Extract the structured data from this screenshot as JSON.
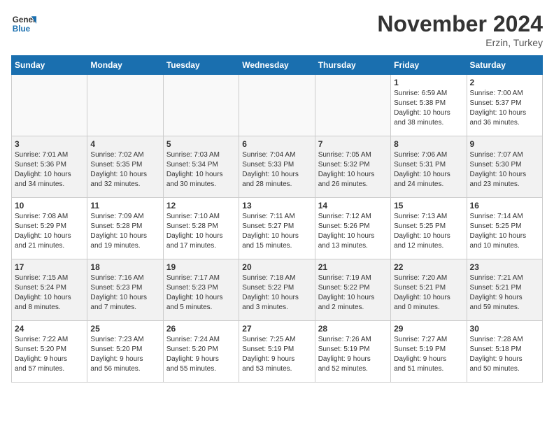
{
  "header": {
    "logo_line1": "General",
    "logo_line2": "Blue",
    "month": "November 2024",
    "location": "Erzin, Turkey"
  },
  "days_of_week": [
    "Sunday",
    "Monday",
    "Tuesday",
    "Wednesday",
    "Thursday",
    "Friday",
    "Saturday"
  ],
  "weeks": [
    [
      {
        "day": "",
        "info": ""
      },
      {
        "day": "",
        "info": ""
      },
      {
        "day": "",
        "info": ""
      },
      {
        "day": "",
        "info": ""
      },
      {
        "day": "",
        "info": ""
      },
      {
        "day": "1",
        "info": "Sunrise: 6:59 AM\nSunset: 5:38 PM\nDaylight: 10 hours\nand 38 minutes."
      },
      {
        "day": "2",
        "info": "Sunrise: 7:00 AM\nSunset: 5:37 PM\nDaylight: 10 hours\nand 36 minutes."
      }
    ],
    [
      {
        "day": "3",
        "info": "Sunrise: 7:01 AM\nSunset: 5:36 PM\nDaylight: 10 hours\nand 34 minutes."
      },
      {
        "day": "4",
        "info": "Sunrise: 7:02 AM\nSunset: 5:35 PM\nDaylight: 10 hours\nand 32 minutes."
      },
      {
        "day": "5",
        "info": "Sunrise: 7:03 AM\nSunset: 5:34 PM\nDaylight: 10 hours\nand 30 minutes."
      },
      {
        "day": "6",
        "info": "Sunrise: 7:04 AM\nSunset: 5:33 PM\nDaylight: 10 hours\nand 28 minutes."
      },
      {
        "day": "7",
        "info": "Sunrise: 7:05 AM\nSunset: 5:32 PM\nDaylight: 10 hours\nand 26 minutes."
      },
      {
        "day": "8",
        "info": "Sunrise: 7:06 AM\nSunset: 5:31 PM\nDaylight: 10 hours\nand 24 minutes."
      },
      {
        "day": "9",
        "info": "Sunrise: 7:07 AM\nSunset: 5:30 PM\nDaylight: 10 hours\nand 23 minutes."
      }
    ],
    [
      {
        "day": "10",
        "info": "Sunrise: 7:08 AM\nSunset: 5:29 PM\nDaylight: 10 hours\nand 21 minutes."
      },
      {
        "day": "11",
        "info": "Sunrise: 7:09 AM\nSunset: 5:28 PM\nDaylight: 10 hours\nand 19 minutes."
      },
      {
        "day": "12",
        "info": "Sunrise: 7:10 AM\nSunset: 5:28 PM\nDaylight: 10 hours\nand 17 minutes."
      },
      {
        "day": "13",
        "info": "Sunrise: 7:11 AM\nSunset: 5:27 PM\nDaylight: 10 hours\nand 15 minutes."
      },
      {
        "day": "14",
        "info": "Sunrise: 7:12 AM\nSunset: 5:26 PM\nDaylight: 10 hours\nand 13 minutes."
      },
      {
        "day": "15",
        "info": "Sunrise: 7:13 AM\nSunset: 5:25 PM\nDaylight: 10 hours\nand 12 minutes."
      },
      {
        "day": "16",
        "info": "Sunrise: 7:14 AM\nSunset: 5:25 PM\nDaylight: 10 hours\nand 10 minutes."
      }
    ],
    [
      {
        "day": "17",
        "info": "Sunrise: 7:15 AM\nSunset: 5:24 PM\nDaylight: 10 hours\nand 8 minutes."
      },
      {
        "day": "18",
        "info": "Sunrise: 7:16 AM\nSunset: 5:23 PM\nDaylight: 10 hours\nand 7 minutes."
      },
      {
        "day": "19",
        "info": "Sunrise: 7:17 AM\nSunset: 5:23 PM\nDaylight: 10 hours\nand 5 minutes."
      },
      {
        "day": "20",
        "info": "Sunrise: 7:18 AM\nSunset: 5:22 PM\nDaylight: 10 hours\nand 3 minutes."
      },
      {
        "day": "21",
        "info": "Sunrise: 7:19 AM\nSunset: 5:22 PM\nDaylight: 10 hours\nand 2 minutes."
      },
      {
        "day": "22",
        "info": "Sunrise: 7:20 AM\nSunset: 5:21 PM\nDaylight: 10 hours\nand 0 minutes."
      },
      {
        "day": "23",
        "info": "Sunrise: 7:21 AM\nSunset: 5:21 PM\nDaylight: 9 hours\nand 59 minutes."
      }
    ],
    [
      {
        "day": "24",
        "info": "Sunrise: 7:22 AM\nSunset: 5:20 PM\nDaylight: 9 hours\nand 57 minutes."
      },
      {
        "day": "25",
        "info": "Sunrise: 7:23 AM\nSunset: 5:20 PM\nDaylight: 9 hours\nand 56 minutes."
      },
      {
        "day": "26",
        "info": "Sunrise: 7:24 AM\nSunset: 5:20 PM\nDaylight: 9 hours\nand 55 minutes."
      },
      {
        "day": "27",
        "info": "Sunrise: 7:25 AM\nSunset: 5:19 PM\nDaylight: 9 hours\nand 53 minutes."
      },
      {
        "day": "28",
        "info": "Sunrise: 7:26 AM\nSunset: 5:19 PM\nDaylight: 9 hours\nand 52 minutes."
      },
      {
        "day": "29",
        "info": "Sunrise: 7:27 AM\nSunset: 5:19 PM\nDaylight: 9 hours\nand 51 minutes."
      },
      {
        "day": "30",
        "info": "Sunrise: 7:28 AM\nSunset: 5:18 PM\nDaylight: 9 hours\nand 50 minutes."
      }
    ]
  ]
}
